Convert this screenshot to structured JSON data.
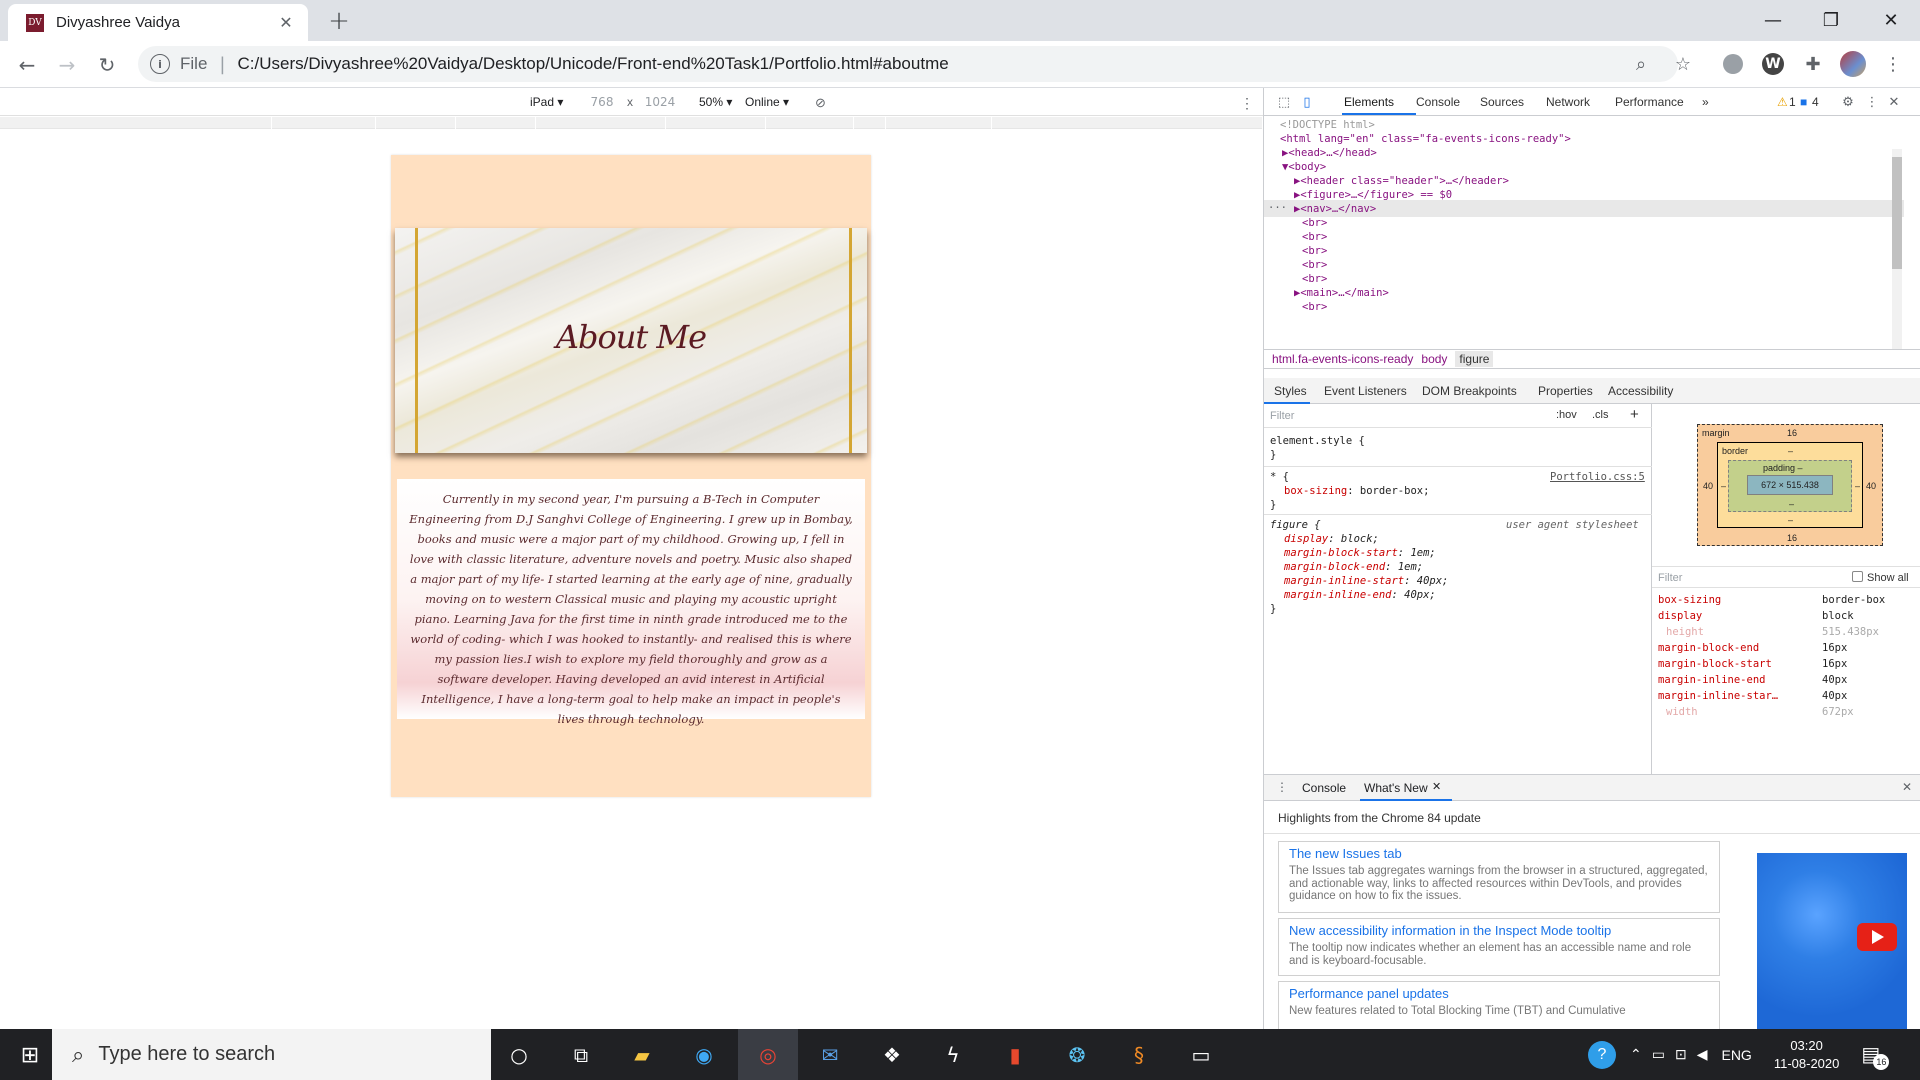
{
  "window": {
    "tab_title": "Divyashree Vaidya",
    "favicon_text": "DV",
    "minimize": "—",
    "maximize": "❐",
    "close": "✕"
  },
  "toolbar": {
    "scheme": "File",
    "url": "C:/Users/Divyashree%20Vaidya/Desktop/Unicode/Front-end%20Task1/Portfolio.html#aboutme"
  },
  "device_toolbar": {
    "device": "iPad ▾",
    "width": "768",
    "times": "x",
    "height": "1024",
    "zoom": "50% ▾",
    "network": "Online ▾"
  },
  "page": {
    "hero_title": "About Me",
    "bio": "Currently in my second year, I'm pursuing a B-Tech in Computer Engineering from D.J Sanghvi College of Engineering. I grew up in Bombay, books and music were a major part of my childhood. Growing up, I fell in love with classic literature, adventure novels and poetry. Music also shaped a major part of my life- I started learning at the early age of nine, gradually moving on to western Classical music and playing my acoustic upright piano. Learning Java for the first time in ninth grade introduced me to the world of coding- which I was hooked to instantly- and realised this is where my passion lies.I wish to explore my field thoroughly and grow as a software developer. Having developed an avid interest in Artificial Intelligence, I have a long-term goal to help make an impact in people's lives through technology."
  },
  "devtools": {
    "tabs": [
      "Elements",
      "Console",
      "Sources",
      "Network",
      "Performance",
      "»"
    ],
    "warnings": "1",
    "messages": "4",
    "dom": [
      "<!DOCTYPE html>",
      "<html lang=\"en\" class=\"fa-events-icons-ready\">",
      "▶<head>…</head>",
      "▼<body>",
      "▶<header class=\"header\">…</header>",
      "▶<figure>…</figure> == $0",
      "▶<nav>…</nav>",
      "<br>",
      "<br>",
      "<br>",
      "<br>",
      "<br>",
      "▶<main>…</main>",
      "<br>"
    ],
    "dom_gutter": "···",
    "breadcrumbs": [
      "html.fa-events-icons-ready",
      "body",
      "figure"
    ],
    "subtabs": [
      "Styles",
      "Event Listeners",
      "DOM Breakpoints",
      "Properties",
      "Accessibility"
    ],
    "styles": {
      "filter_placeholder": "Filter",
      "hov": ":hov",
      "cls": ".cls",
      "plus": "+",
      "element_style": "element.style {",
      "close_brace": "}",
      "star_rule": "* {",
      "star_source": "Portfolio.css:5",
      "box_sizing": "box-sizing",
      "box_sizing_val": "border-box;",
      "figure_rule": "figure {",
      "ua": "user agent stylesheet",
      "figure_props": [
        {
          "prop": "display",
          "val": "block;"
        },
        {
          "prop": "margin-block-start",
          "val": "1em;"
        },
        {
          "prop": "margin-block-end",
          "val": "1em;"
        },
        {
          "prop": "margin-inline-start",
          "val": "40px;"
        },
        {
          "prop": "margin-inline-end",
          "val": "40px;"
        }
      ]
    },
    "box_model": {
      "margin_label": "margin",
      "margin_top": "16",
      "margin_bottom": "16",
      "margin_left": "40",
      "margin_right": "40",
      "border_label": "border",
      "border_dash": "–",
      "padding_label": "padding –",
      "content": "672 × 515.438"
    },
    "computed": {
      "filter": "Filter",
      "show_all": "Show all",
      "rows": [
        {
          "prop": "box-sizing",
          "val": "border-box",
          "dim": false
        },
        {
          "prop": "display",
          "val": "block",
          "dim": false
        },
        {
          "prop": "height",
          "val": "515.438px",
          "dim": true
        },
        {
          "prop": "margin-block-end",
          "val": "16px",
          "dim": false
        },
        {
          "prop": "margin-block-start",
          "val": "16px",
          "dim": false
        },
        {
          "prop": "margin-inline-end",
          "val": "40px",
          "dim": false
        },
        {
          "prop": "margin-inline-star…",
          "val": "40px",
          "dim": false
        },
        {
          "prop": "width",
          "val": "672px",
          "dim": true
        }
      ]
    },
    "drawer": {
      "tab_console": "Console",
      "tab_whats_new": "What's New",
      "headline": "Highlights from the Chrome 84 update",
      "cards": [
        {
          "title": "The new Issues tab",
          "desc": "The Issues tab aggregates warnings from the browser in a structured, aggregated, and actionable way, links to affected resources within DevTools, and provides guidance on how to fix the issues."
        },
        {
          "title": "New accessibility information in the Inspect Mode tooltip",
          "desc": "The tooltip now indicates whether an element has an accessible name and role and is keyboard-focusable."
        },
        {
          "title": "Performance panel updates",
          "desc": "New features related to Total Blocking Time (TBT) and Cumulative"
        }
      ]
    }
  },
  "taskbar": {
    "search_placeholder": "Type here to search",
    "lang": "ENG",
    "time": "03:20",
    "date": "11-08-2020",
    "notif_count": "16"
  }
}
